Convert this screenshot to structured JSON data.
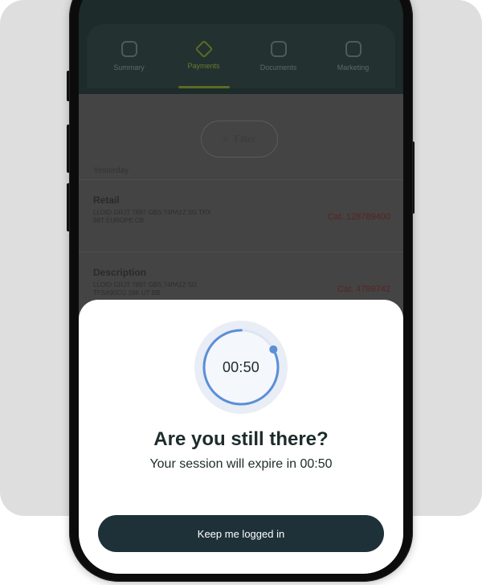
{
  "background_app": {
    "tabs": [
      {
        "label": "Summary",
        "icon": "home-icon",
        "active": false
      },
      {
        "label": "Payments",
        "icon": "transfer-icon",
        "active": true
      },
      {
        "label": "Documents",
        "icon": "document-icon",
        "active": false
      },
      {
        "label": "Marketing",
        "icon": "cart-icon",
        "active": false
      }
    ],
    "filter_label": "Filter",
    "section_label": "Yesterday",
    "rows": [
      {
        "title": "Retail",
        "description": "LLOID GRJT 7897 GBS 74PA12 SG TPX 98T EUROPE CB",
        "amount": "Cat. 128789400"
      },
      {
        "title": "Description",
        "description": "LLOID GRJT 7897 GBS 74PA12 SG TFSA90CG 16K UT BB",
        "amount": "Cat. 4789742"
      }
    ]
  },
  "session_sheet": {
    "timer_display": "00:50",
    "timer_remaining_fraction": 0.83,
    "title": "Are you still there?",
    "subtitle": "Your session will expire in 00:50",
    "keep_button_label": "Keep me logged in"
  },
  "colors": {
    "brand_dark": "#1f3138",
    "timer_accent": "#5b8fd6",
    "timer_track": "#e8edf6"
  }
}
